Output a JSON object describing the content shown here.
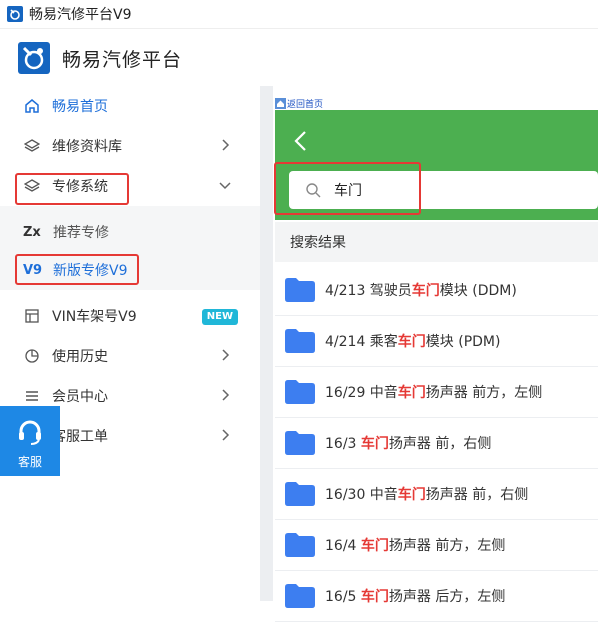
{
  "window": {
    "title": "畅易汽修平台V9"
  },
  "brand": {
    "name": "畅易汽修平台"
  },
  "sidebar": {
    "items": [
      {
        "label": "畅易首页",
        "icon": "home-icon"
      },
      {
        "label": "维修资料库",
        "icon": "layers-icon"
      },
      {
        "label": "专修系统",
        "icon": "layers-icon"
      },
      {
        "label": "VIN车架号V9",
        "icon": "vin-card-icon",
        "badge": "NEW"
      },
      {
        "label": "使用历史",
        "icon": "pie-chart-icon"
      },
      {
        "label": "会员中心",
        "icon": "menu-lines-icon"
      },
      {
        "label": "客服工单",
        "icon": "ticket-icon"
      }
    ],
    "sub_items": [
      {
        "code": "Zx",
        "label": "推荐专修"
      },
      {
        "code": "V9",
        "label": "新版专修V9"
      }
    ]
  },
  "customer_service": {
    "label": "客服"
  },
  "main": {
    "back_home": "返回首页",
    "search": {
      "value": "车门"
    },
    "results_header": "搜索结果",
    "results": [
      {
        "pre": "4/213 驾驶员",
        "hl": "车门",
        "post": "模块 (DDM)"
      },
      {
        "pre": "4/214 乘客",
        "hl": "车门",
        "post": "模块 (PDM)"
      },
      {
        "pre": "16/29 中音",
        "hl": "车门",
        "post": "扬声器 前方，左侧"
      },
      {
        "pre": "16/3 ",
        "hl": "车门",
        "post": "扬声器 前，右侧"
      },
      {
        "pre": "16/30 中音",
        "hl": "车门",
        "post": "扬声器 前，右侧"
      },
      {
        "pre": "16/4 ",
        "hl": "车门",
        "post": "扬声器 前方，左侧"
      },
      {
        "pre": "16/5 ",
        "hl": "车门",
        "post": "扬声器 后方，左侧"
      }
    ]
  },
  "colors": {
    "accent": "#1e6fd9",
    "green": "#4caf50",
    "highlight": "#e53935",
    "badge": "#20b7d8",
    "folder": "#3d7ef0"
  }
}
